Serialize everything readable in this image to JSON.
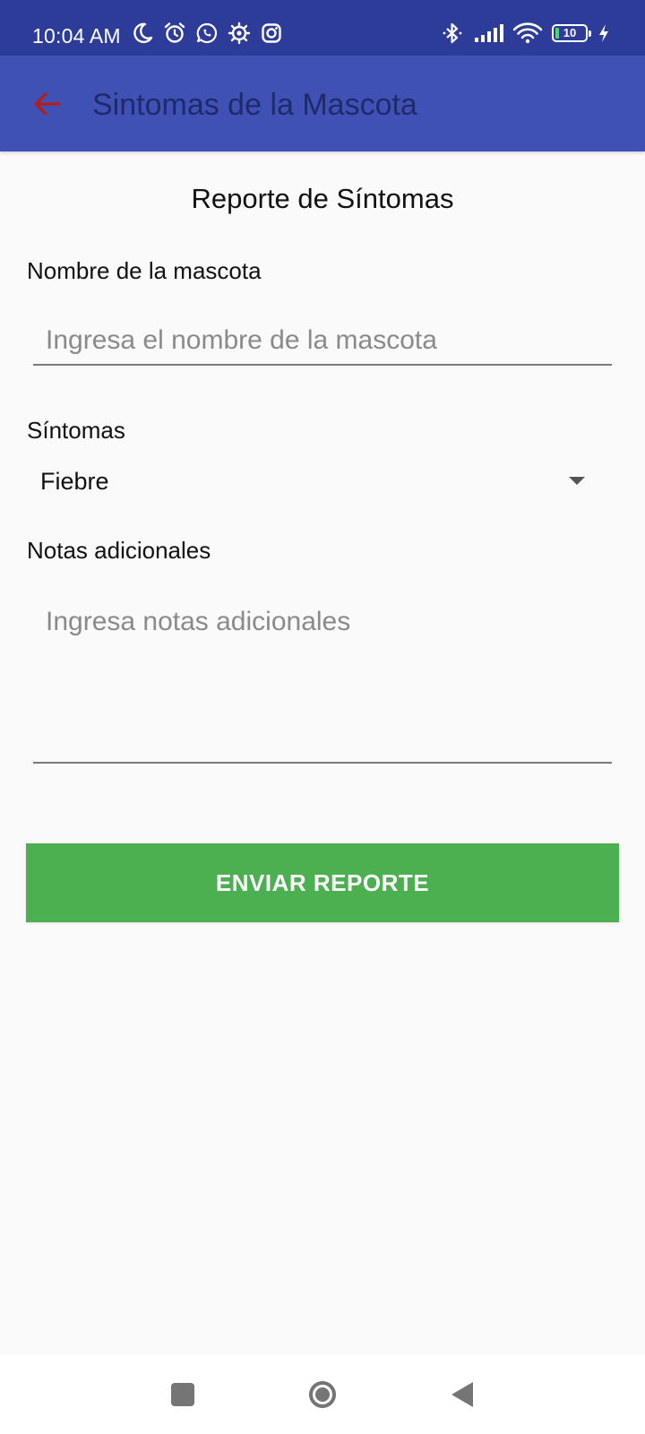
{
  "status_bar": {
    "time": "10:04 AM",
    "left_icons": [
      "moon-icon",
      "alarm-icon",
      "whatsapp-icon",
      "settings-icon",
      "instagram-icon"
    ],
    "right_icons": [
      "bluetooth-icon",
      "signal-icon",
      "wifi-icon",
      "battery-icon",
      "charging-icon"
    ],
    "battery_level": "10",
    "battery_color": "#4cd964"
  },
  "app_bar": {
    "title": "Sintomas de la Mascota",
    "back_icon": "arrow-back-icon",
    "back_icon_color": "#b71c1c",
    "background": "#3f51b5"
  },
  "form": {
    "title": "Reporte de Síntomas",
    "pet_name": {
      "label": "Nombre de la mascota",
      "placeholder": "Ingresa el nombre de la mascota",
      "value": ""
    },
    "symptoms": {
      "label": "Síntomas",
      "selected": "Fiebre"
    },
    "notes": {
      "label": "Notas adicionales",
      "placeholder": "Ingresa notas adicionales",
      "value": ""
    },
    "submit_label": "ENVIAR REPORTE",
    "submit_color": "#4caf50"
  },
  "nav_bar": {
    "buttons": [
      "recents-icon",
      "home-icon",
      "back-icon"
    ]
  }
}
